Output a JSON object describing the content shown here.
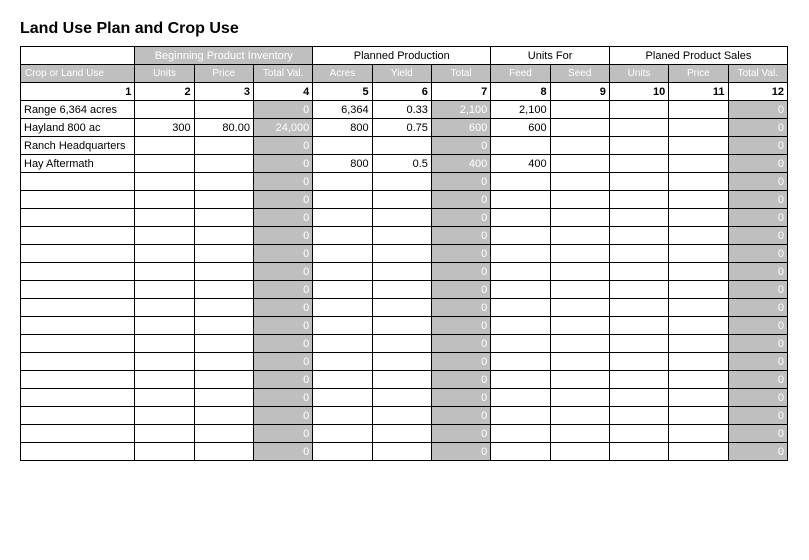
{
  "title": "Land Use Plan and Crop Use",
  "groups": {
    "g1": "Beginning Product Inventory",
    "g2": "Planned Production",
    "g3": "Units For",
    "g4": "Planed Product Sales"
  },
  "columns": {
    "crop": "Crop or Land Use",
    "bpi_units": "Units",
    "bpi_price": "Price",
    "bpi_total": "Total Val.",
    "pp_acres": "Acres",
    "pp_yield": "Yield",
    "pp_total": "Total",
    "uf_feed": "Feed",
    "uf_seed": "Seed",
    "ps_units": "Units",
    "ps_price": "Price",
    "ps_total": "Total Val."
  },
  "index": [
    "1",
    "2",
    "3",
    "4",
    "5",
    "6",
    "7",
    "8",
    "9",
    "10",
    "11",
    "12"
  ],
  "rows": [
    {
      "crop": "Range 6,364 acres",
      "bpi_units": "",
      "bpi_price": "",
      "bpi_total": "0",
      "pp_acres": "6,364",
      "pp_yield": "0.33",
      "pp_total": "2,100",
      "uf_feed": "2,100",
      "uf_seed": "",
      "ps_units": "",
      "ps_price": "",
      "ps_total": "0"
    },
    {
      "crop": "Hayland 800 ac",
      "bpi_units": "300",
      "bpi_price": "80.00",
      "bpi_total": "24,000",
      "pp_acres": "800",
      "pp_yield": "0.75",
      "pp_total": "600",
      "uf_feed": "600",
      "uf_seed": "",
      "ps_units": "",
      "ps_price": "",
      "ps_total": "0"
    },
    {
      "crop": "Ranch Headquarters",
      "bpi_units": "",
      "bpi_price": "",
      "bpi_total": "0",
      "pp_acres": "",
      "pp_yield": "",
      "pp_total": "0",
      "uf_feed": "",
      "uf_seed": "",
      "ps_units": "",
      "ps_price": "",
      "ps_total": "0"
    },
    {
      "crop": "Hay Aftermath",
      "bpi_units": "",
      "bpi_price": "",
      "bpi_total": "0",
      "pp_acres": "800",
      "pp_yield": "0.5",
      "pp_total": "400",
      "uf_feed": "400",
      "uf_seed": "",
      "ps_units": "",
      "ps_price": "",
      "ps_total": "0"
    },
    {
      "crop": "",
      "bpi_units": "",
      "bpi_price": "",
      "bpi_total": "0",
      "pp_acres": "",
      "pp_yield": "",
      "pp_total": "0",
      "uf_feed": "",
      "uf_seed": "",
      "ps_units": "",
      "ps_price": "",
      "ps_total": "0"
    },
    {
      "crop": "",
      "bpi_units": "",
      "bpi_price": "",
      "bpi_total": "0",
      "pp_acres": "",
      "pp_yield": "",
      "pp_total": "0",
      "uf_feed": "",
      "uf_seed": "",
      "ps_units": "",
      "ps_price": "",
      "ps_total": "0"
    },
    {
      "crop": "",
      "bpi_units": "",
      "bpi_price": "",
      "bpi_total": "0",
      "pp_acres": "",
      "pp_yield": "",
      "pp_total": "0",
      "uf_feed": "",
      "uf_seed": "",
      "ps_units": "",
      "ps_price": "",
      "ps_total": "0"
    },
    {
      "crop": "",
      "bpi_units": "",
      "bpi_price": "",
      "bpi_total": "0",
      "pp_acres": "",
      "pp_yield": "",
      "pp_total": "0",
      "uf_feed": "",
      "uf_seed": "",
      "ps_units": "",
      "ps_price": "",
      "ps_total": "0"
    },
    {
      "crop": "",
      "bpi_units": "",
      "bpi_price": "",
      "bpi_total": "0",
      "pp_acres": "",
      "pp_yield": "",
      "pp_total": "0",
      "uf_feed": "",
      "uf_seed": "",
      "ps_units": "",
      "ps_price": "",
      "ps_total": "0"
    },
    {
      "crop": "",
      "bpi_units": "",
      "bpi_price": "",
      "bpi_total": "0",
      "pp_acres": "",
      "pp_yield": "",
      "pp_total": "0",
      "uf_feed": "",
      "uf_seed": "",
      "ps_units": "",
      "ps_price": "",
      "ps_total": "0"
    },
    {
      "crop": "",
      "bpi_units": "",
      "bpi_price": "",
      "bpi_total": "0",
      "pp_acres": "",
      "pp_yield": "",
      "pp_total": "0",
      "uf_feed": "",
      "uf_seed": "",
      "ps_units": "",
      "ps_price": "",
      "ps_total": "0"
    },
    {
      "crop": "",
      "bpi_units": "",
      "bpi_price": "",
      "bpi_total": "0",
      "pp_acres": "",
      "pp_yield": "",
      "pp_total": "0",
      "uf_feed": "",
      "uf_seed": "",
      "ps_units": "",
      "ps_price": "",
      "ps_total": "0"
    },
    {
      "crop": "",
      "bpi_units": "",
      "bpi_price": "",
      "bpi_total": "0",
      "pp_acres": "",
      "pp_yield": "",
      "pp_total": "0",
      "uf_feed": "",
      "uf_seed": "",
      "ps_units": "",
      "ps_price": "",
      "ps_total": "0"
    },
    {
      "crop": "",
      "bpi_units": "",
      "bpi_price": "",
      "bpi_total": "0",
      "pp_acres": "",
      "pp_yield": "",
      "pp_total": "0",
      "uf_feed": "",
      "uf_seed": "",
      "ps_units": "",
      "ps_price": "",
      "ps_total": "0"
    },
    {
      "crop": "",
      "bpi_units": "",
      "bpi_price": "",
      "bpi_total": "0",
      "pp_acres": "",
      "pp_yield": "",
      "pp_total": "0",
      "uf_feed": "",
      "uf_seed": "",
      "ps_units": "",
      "ps_price": "",
      "ps_total": "0"
    },
    {
      "crop": "",
      "bpi_units": "",
      "bpi_price": "",
      "bpi_total": "0",
      "pp_acres": "",
      "pp_yield": "",
      "pp_total": "0",
      "uf_feed": "",
      "uf_seed": "",
      "ps_units": "",
      "ps_price": "",
      "ps_total": "0"
    },
    {
      "crop": "",
      "bpi_units": "",
      "bpi_price": "",
      "bpi_total": "0",
      "pp_acres": "",
      "pp_yield": "",
      "pp_total": "0",
      "uf_feed": "",
      "uf_seed": "",
      "ps_units": "",
      "ps_price": "",
      "ps_total": "0"
    },
    {
      "crop": "",
      "bpi_units": "",
      "bpi_price": "",
      "bpi_total": "0",
      "pp_acres": "",
      "pp_yield": "",
      "pp_total": "0",
      "uf_feed": "",
      "uf_seed": "",
      "ps_units": "",
      "ps_price": "",
      "ps_total": "0"
    },
    {
      "crop": "",
      "bpi_units": "",
      "bpi_price": "",
      "bpi_total": "0",
      "pp_acres": "",
      "pp_yield": "",
      "pp_total": "0",
      "uf_feed": "",
      "uf_seed": "",
      "ps_units": "",
      "ps_price": "",
      "ps_total": "0"
    },
    {
      "crop": "",
      "bpi_units": "",
      "bpi_price": "",
      "bpi_total": "0",
      "pp_acres": "",
      "pp_yield": "",
      "pp_total": "0",
      "uf_feed": "",
      "uf_seed": "",
      "ps_units": "",
      "ps_price": "",
      "ps_total": "0"
    }
  ]
}
